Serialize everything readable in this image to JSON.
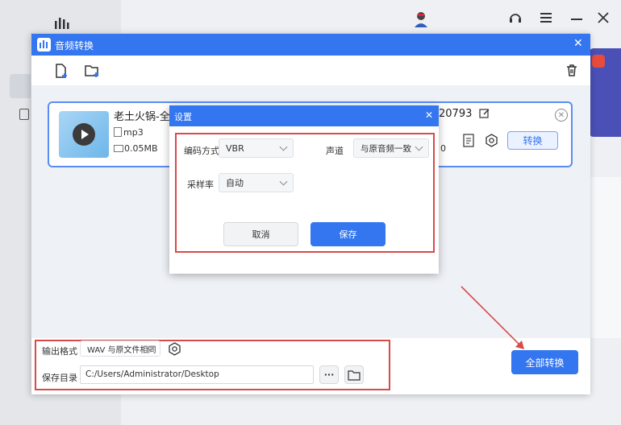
{
  "dialog": {
    "title": "音频转换",
    "close_glyph": "✕",
    "toolbar": {
      "add_file_icon": "add-file-icon",
      "add_folder_icon": "add-folder-icon",
      "delete_icon": "trash-icon"
    }
  },
  "file": {
    "name_visible_left": "老土火锅-全能",
    "name_visible_right": "20793",
    "format": "mp3",
    "size": "0.05MB",
    "convert_label": "转换",
    "partial_value_peek": "0"
  },
  "footer": {
    "output_format_label": "输出格式",
    "output_format_value": "WAV 与原文件相同",
    "save_dir_label": "保存目录",
    "save_dir_value": "C:/Users/Administrator/Desktop",
    "more_glyph": "···",
    "convert_all_label": "全部转换"
  },
  "settings": {
    "title": "设置",
    "close_glyph": "✕",
    "encoding_label": "编码方式",
    "encoding_value": "VBR",
    "channel_label": "声道",
    "channel_value": "与原音频一致",
    "samplerate_label": "采样率",
    "samplerate_value": "自动",
    "cancel_label": "取消",
    "save_label": "保存"
  },
  "colors": {
    "accent": "#3376f0",
    "annotation_red": "#d94a4a"
  }
}
